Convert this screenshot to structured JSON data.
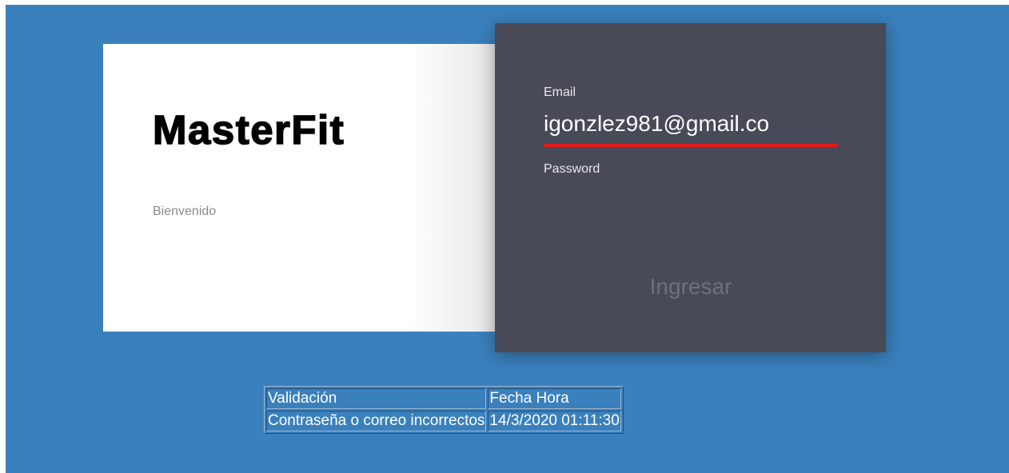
{
  "welcome": {
    "brand": "MasterFit",
    "greeting": "Bienvenido"
  },
  "login": {
    "email_label": "Email",
    "email_value": "igonzlez981@gmail.co",
    "password_label": "Password",
    "password_value": "",
    "submit_label": "Ingresar"
  },
  "results": {
    "headers": [
      "Validación",
      "Fecha Hora"
    ],
    "rows": [
      [
        "Contraseña o correo incorrectos",
        "14/3/2020 01:11:30"
      ]
    ]
  },
  "colors": {
    "background": "#3a80bd",
    "login_card": "#484a57",
    "accent_underline": "#e41b1b"
  }
}
